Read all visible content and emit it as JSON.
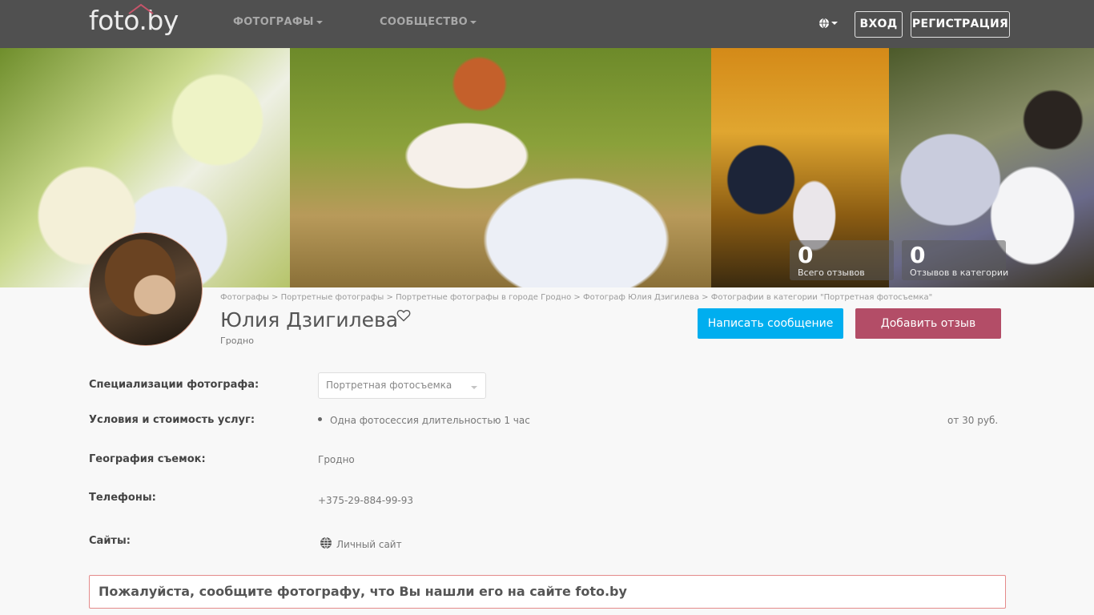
{
  "header": {
    "logo": "foto.by",
    "nav": [
      {
        "label": "ФОТОГРАФЫ"
      },
      {
        "label": "СООБЩЕСТВО"
      }
    ],
    "login": "ВХОД",
    "register": "РЕГИСТРАЦИЯ",
    "globe_icon": "globe-icon"
  },
  "banner": {
    "stats": [
      {
        "value": "0",
        "label": "Всего отзывов"
      },
      {
        "value": "0",
        "label": "Отзывов в категории"
      }
    ]
  },
  "profile": {
    "breadcrumbs": [
      "Фотографы",
      "Портретные фотографы",
      "Портретные фотографы в городе Гродно",
      "Фотограф Юлия Дзигилева",
      "Фотографии в категории \"Портретная фотосъемка\""
    ],
    "breadcrumb_separator": ">",
    "name": "Юлия Дзигилева",
    "city": "Гродно",
    "message_button": "Написать сообщение",
    "review_button": "Добавить отзыв"
  },
  "details": {
    "specialization_label": "Специализации фотографа:",
    "specialization_value": "Портретная фотосъемка",
    "services_label": "Условия и стоимость услуг:",
    "service_item": "Одна фотосессия длительностью 1 час",
    "service_price": "от 30 руб.",
    "geography_label": "География съемок:",
    "geography_value": "Гродно",
    "phones_label": "Телефоны:",
    "phone_value": "+375-29-884-99-93",
    "sites_label": "Сайты:",
    "site_value": "Личный сайт"
  },
  "notice": "Пожалуйста, сообщите фотографу, что Вы нашли его на сайте foto.by",
  "colors": {
    "header_bg": "#505050",
    "message_button": "#00aeef",
    "review_button": "#b34d67",
    "notice_border": "#e48a8a"
  }
}
